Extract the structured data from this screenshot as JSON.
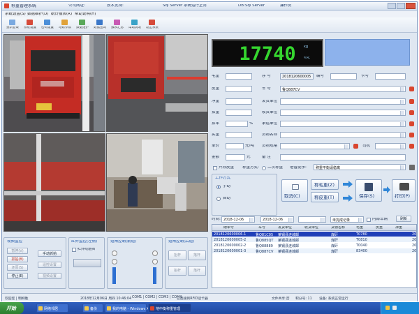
{
  "window": {
    "title": "称重管理系统",
    "title_items": [
      "公司网址:",
      "技术支持:",
      "Sql Server 系统运行正常",
      "DB:Sql Server",
      "操作员"
    ]
  },
  "menu": [
    "系统设置(S)",
    "数据维护(D)",
    "统计报表(R)",
    "帮助说明(H)"
  ],
  "toolbar": {
    "buttons": [
      {
        "label": "重新登录",
        "icon": "relogin-icon",
        "color": "#7aa9e0"
      },
      {
        "label": "系统设置",
        "icon": "settings-icon",
        "color": "#d64a3a"
      },
      {
        "label": "密码设置",
        "icon": "password-icon",
        "color": "#4c8fd8"
      },
      {
        "label": "地磅参数",
        "icon": "scale-params-icon",
        "color": "#e0a23a"
      },
      {
        "label": "数据维护",
        "icon": "data-maint-icon",
        "color": "#5aa85a"
      },
      {
        "label": "数据查询",
        "icon": "data-query-icon",
        "color": "#3a77c8"
      },
      {
        "label": "报表汇总",
        "icon": "report-icon",
        "color": "#c85ab4"
      },
      {
        "label": "帮助说明",
        "icon": "help-icon",
        "color": "#3aa3c8"
      },
      {
        "label": "退出系统",
        "icon": "exit-icon",
        "color": "#d64a3a"
      }
    ]
  },
  "weight": {
    "value": "17740",
    "unit": "kg",
    "stable": "稳定"
  },
  "form": {
    "left_labels": [
      "毛重",
      "皮重",
      "净重",
      "扣重",
      "扣率",
      "实重",
      "单价",
      "金额"
    ],
    "left_values": [
      "",
      "",
      "",
      "",
      "",
      "",
      "",
      ""
    ],
    "unit_kl": "%",
    "unit_price": "元/吨",
    "unit_amount": "元",
    "serial_label": "序  号",
    "serial_value": "2018120600005",
    "code_label": "编号",
    "code_value": "",
    "no_label": "卡号",
    "no_value": "",
    "plate_label": "车  号",
    "plate_value": "鲁Q887CV",
    "sender_label": "发货单位",
    "receiver_label": "收货单位",
    "carrier_label": "承运单位",
    "goods_label": "货物名称",
    "spec_label": "货物规格",
    "driver_label": "司机",
    "remark_label": "备  注",
    "checkbox_tare": "只称皮重",
    "weigh_mode_label": "称重方式:",
    "weigh_mode_value": "二次称重",
    "voice_label": "语音提示:",
    "voice_value": "称重平衡请稳离"
  },
  "work_mode": {
    "title": "工作方式",
    "manual": "手动",
    "auto": "自动"
  },
  "actions": {
    "cancel": "取消(C)",
    "gross": "称毛重(Z)",
    "tare": "称皮重(T)",
    "save": "保存(S)",
    "print": "打印(P)"
  },
  "query": {
    "time_label": "时间:",
    "date_from": "2018-12-06",
    "date_to": "2018-12-06",
    "filter_value": "未完成记录",
    "checkbox": "内部车辆",
    "refresh": "刷新"
  },
  "grid": {
    "headers": [
      "磅单号",
      "车号",
      "发货单位",
      "收货单位",
      "货物名称",
      "毛重",
      "皮重",
      "净重"
    ],
    "rows": [
      [
        "2018120600006-1",
        "鲁Q81C05",
        "莱钢县连城邮",
        "",
        "煤矸",
        "T0780",
        "",
        "20"
      ],
      [
        "2018120600005-2",
        "鲁Q885QT",
        "莱钢县连城邮",
        "",
        "煤矸",
        "T0810",
        "",
        "20"
      ],
      [
        "2018120600002-2",
        "鲁Q88889",
        "莱钢县连城邮",
        "",
        "煤矸",
        "T0040",
        "",
        "20"
      ],
      [
        "2018120600001-3",
        "鲁Q887CV",
        "莱钢县连城邮",
        "",
        "煤矸",
        "83400",
        "",
        "20"
      ]
    ]
  },
  "video_panel": {
    "title": "视频监控",
    "btn_pause": "暂停(V)",
    "btn_capture": "抓拍(B)",
    "btn_restore": "还原(S)",
    "btn_stop": "停止(E)",
    "btn_manual": "手动抓拍",
    "btn_remote": "遥控设置",
    "btn_reset": "视频设置"
  },
  "infrared_panel": {
    "title": "红外监控(左侧)",
    "checkbox": "红外线遮挡"
  },
  "gate_panel": {
    "title": "道闸控制(前道)"
  },
  "light_panel": {
    "title": "道闸控制(后道)"
  },
  "light_buttons": [
    "抬杆",
    "落杆",
    "抬杆",
    "落杆"
  ],
  "status": [
    "欢迎您 | 明柳胜",
    "2018年12月06日 周四 10:46:04",
    "COM1 | COM2 | COM3 | COM4",
    "已连接到RFID读卡器",
    "文件共享:否",
    "积分号: 11",
    "设备: 系统正常运行"
  ],
  "taskbar": {
    "start": "开始",
    "tasks": [
      "网络邻居",
      "备份",
      "我的电脑 - Windows X...",
      "地中衡称重管理"
    ]
  }
}
